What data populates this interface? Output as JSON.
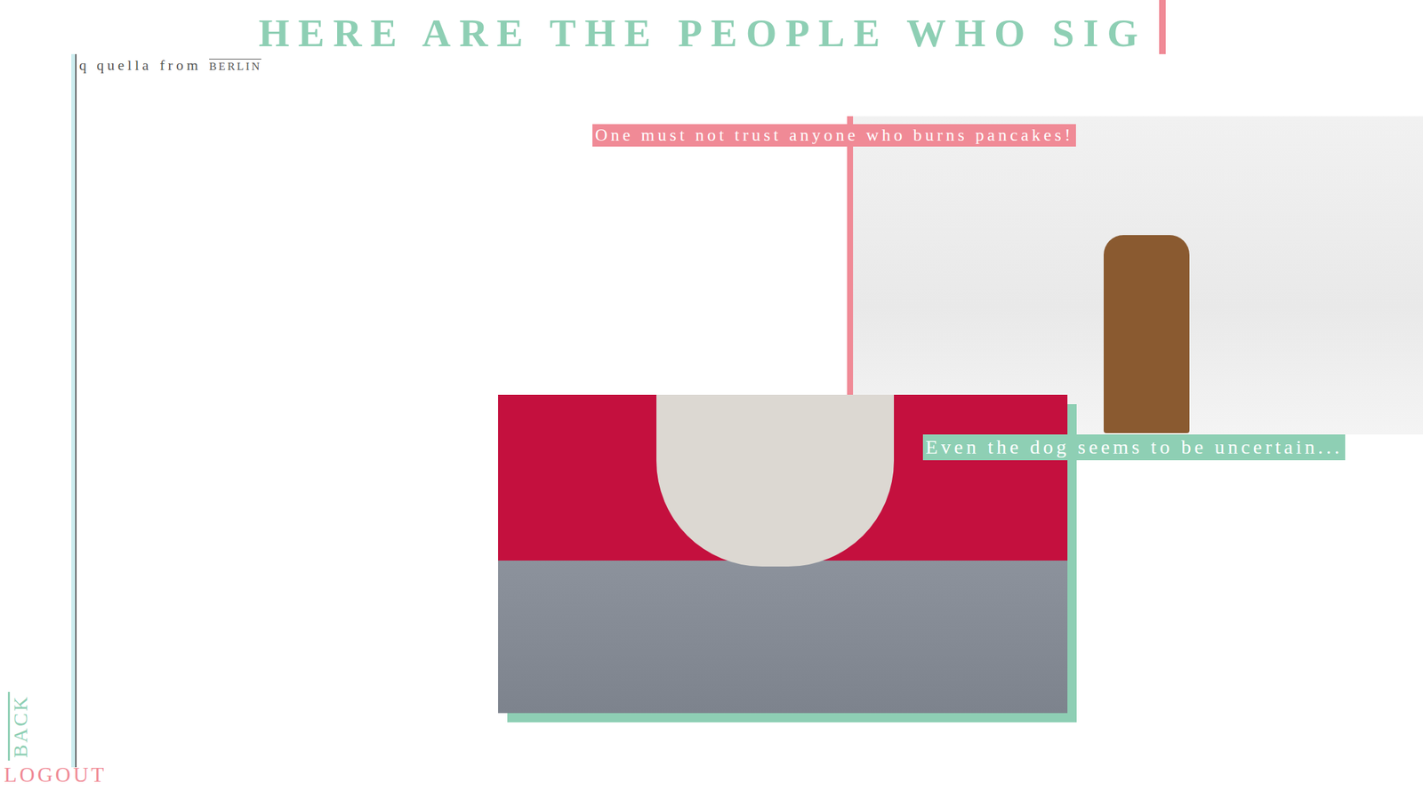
{
  "heading": "HERE ARE THE PEOPLE WHO SIG",
  "user": {
    "name": "q quella",
    "from": "from",
    "city": "BERLIN"
  },
  "posts": [
    {
      "caption": "One must not trust anyone who burns pancakes!",
      "color": "#f08a96"
    },
    {
      "caption": "Even the dog seems to be uncertain...",
      "color": "#8ecfb4"
    }
  ],
  "nav": {
    "back": "BACK",
    "logout": "LOGOUT"
  }
}
